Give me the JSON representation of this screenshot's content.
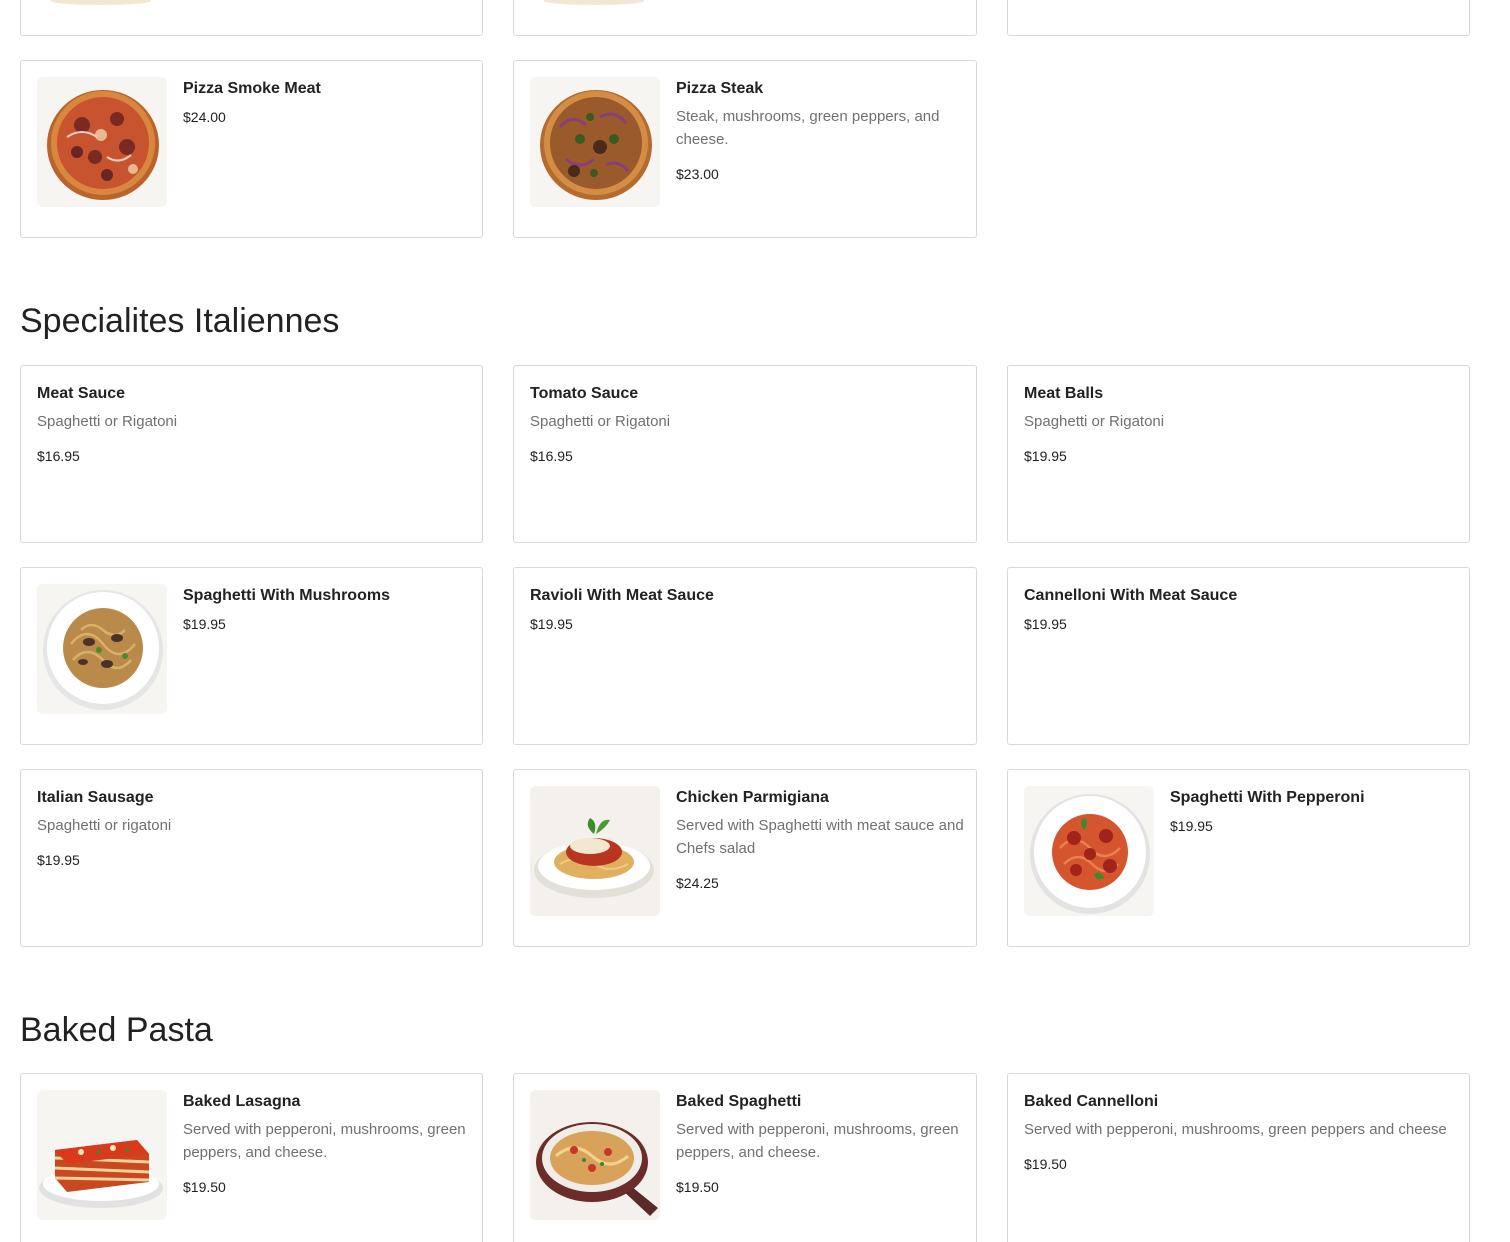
{
  "sections": {
    "specialites": {
      "title": "Specialites Italiennes"
    },
    "baked": {
      "title": "Baked Pasta"
    }
  },
  "items": {
    "pizza_smoke_meat": {
      "name": "Pizza Smoke Meat",
      "price": "$24.00",
      "image": "pizza-smoke-meat-photo"
    },
    "pizza_steak": {
      "name": "Pizza Steak",
      "desc": "Steak, mushrooms, green peppers, and cheese.",
      "price": "$23.00",
      "image": "pizza-steak-photo"
    },
    "meat_sauce": {
      "name": "Meat Sauce",
      "desc": "Spaghetti or Rigatoni",
      "price": "$16.95"
    },
    "tomato_sauce": {
      "name": "Tomato Sauce",
      "desc": "Spaghetti or Rigatoni",
      "price": "$16.95"
    },
    "meat_balls": {
      "name": "Meat Balls",
      "desc": "Spaghetti or Rigatoni",
      "price": "$19.95"
    },
    "spaghetti_mushrooms": {
      "name": "Spaghetti With Mushrooms",
      "price": "$19.95",
      "image": "spaghetti-mushrooms-photo"
    },
    "ravioli_meat_sauce": {
      "name": "Ravioli With Meat Sauce",
      "price": "$19.95"
    },
    "cannelloni_meat_sauce": {
      "name": "Cannelloni With Meat Sauce",
      "price": "$19.95"
    },
    "italian_sausage": {
      "name": "Italian Sausage",
      "desc": "Spaghetti or rigatoni",
      "price": "$19.95"
    },
    "chicken_parmigiana": {
      "name": "Chicken Parmigiana",
      "desc": "Served with Spaghetti with meat sauce and Chefs salad",
      "price": "$24.25",
      "image": "chicken-parmigiana-photo"
    },
    "spaghetti_pepperoni": {
      "name": "Spaghetti With Pepperoni",
      "price": "$19.95",
      "image": "spaghetti-pepperoni-photo"
    },
    "baked_lasagna": {
      "name": "Baked Lasagna",
      "desc": "Served with pepperoni, mushrooms, green peppers, and cheese.",
      "price": "$19.50",
      "image": "baked-lasagna-photo"
    },
    "baked_spaghetti": {
      "name": "Baked Spaghetti",
      "desc": "Served with pepperoni, mushrooms, green peppers, and cheese.",
      "price": "$19.50",
      "image": "baked-spaghetti-photo"
    },
    "baked_cannelloni": {
      "name": "Baked Cannelloni",
      "desc": "Served with pepperoni, mushrooms, green peppers and cheese",
      "price": "$19.50"
    }
  },
  "colors": {
    "card_border": "#d9d9d9",
    "text": "#222222",
    "muted_text": "#707070"
  }
}
